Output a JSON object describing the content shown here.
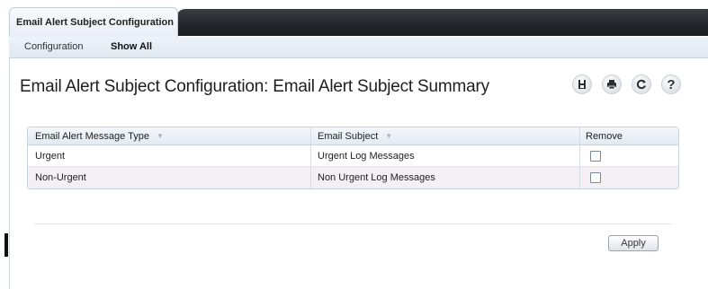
{
  "tab": {
    "label": "Email Alert Subject Configuration"
  },
  "subnav": {
    "items": [
      {
        "label": "Configuration"
      },
      {
        "label": "Show All"
      }
    ]
  },
  "page": {
    "title": "Email Alert Subject Configuration: Email Alert Subject Summary"
  },
  "toolbar": {
    "icons": [
      "save-icon",
      "print-icon",
      "refresh-icon",
      "help-icon"
    ],
    "help_glyph": "?"
  },
  "table": {
    "headers": {
      "type": "Email Alert Message Type",
      "subject": "Email Subject",
      "remove": "Remove"
    },
    "sort_glyph": "▼",
    "rows": [
      {
        "type": "Urgent",
        "subject": "Urgent Log Messages",
        "remove": false
      },
      {
        "type": "Non-Urgent",
        "subject": "Non Urgent Log Messages",
        "remove": false
      }
    ]
  },
  "actions": {
    "apply_label": "Apply"
  },
  "colors": {
    "dark_bar": "#23262a",
    "row_alt": "#f3eff5",
    "header_bg": "#e3eaf2"
  }
}
